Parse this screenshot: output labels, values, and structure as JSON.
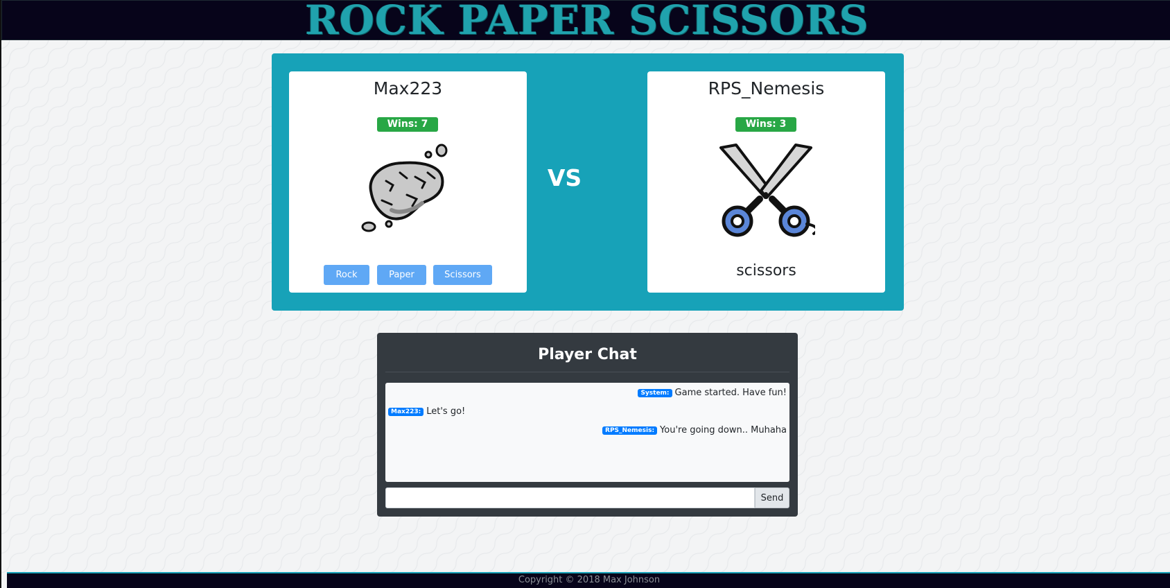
{
  "header": {
    "title": "ROCK PAPER SCISSORS"
  },
  "game": {
    "vs_label": "VS",
    "player1": {
      "name": "Max223",
      "wins_label": "Wins: 7",
      "choice_icon": "rock-icon",
      "buttons": {
        "rock": "Rock",
        "paper": "Paper",
        "scissors": "Scissors"
      },
      "button_color": "#5fa8f5"
    },
    "player2": {
      "name": "RPS_Nemesis",
      "wins_label": "Wins: 3",
      "choice_icon": "scissors-icon",
      "choice_text": "scissors"
    },
    "panel_color": "#17a2b8",
    "wins_badge_color": "#28a745"
  },
  "chat": {
    "title": "Player Chat",
    "messages": [
      {
        "sender": "System:",
        "text": "Game started. Have fun!",
        "align": "right"
      },
      {
        "sender": "Max223:",
        "text": "Let's go!",
        "align": "left"
      },
      {
        "sender": "RPS_Nemesis:",
        "text": "You're going down.. Muhaha",
        "align": "right"
      }
    ],
    "input_value": "",
    "send_label": "Send",
    "sender_badge_color": "#007bff"
  },
  "footer": {
    "copyright": "Copyright © 2018 Max Johnson"
  }
}
